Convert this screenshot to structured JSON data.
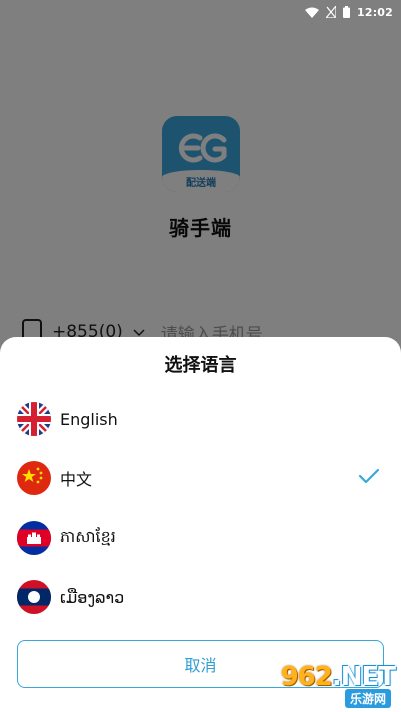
{
  "status_bar": {
    "time": "12:02"
  },
  "background_app": {
    "logo_caption": "配送端",
    "app_name": "骑手端",
    "country_code": "+855(0)",
    "phone_placeholder": "请输入手机号"
  },
  "language_sheet": {
    "title": "选择语言",
    "languages": [
      {
        "label": "English",
        "flag": "uk-flag",
        "selected": false
      },
      {
        "label": "中文",
        "flag": "china-flag",
        "selected": true
      },
      {
        "label": "ភាសាខ្មែរ",
        "flag": "cambodia-flag",
        "selected": false
      },
      {
        "label": "ເມືອງລາວ",
        "flag": "laos-flag",
        "selected": false
      }
    ],
    "cancel_label": "取消"
  },
  "watermark": {
    "brand_prefix": "962",
    "brand_suffix": ".NET",
    "sub": "乐游网"
  },
  "colors": {
    "accent": "#2f9fd0",
    "check": "#37a9d8",
    "logo_bg": "#3aa7df"
  }
}
